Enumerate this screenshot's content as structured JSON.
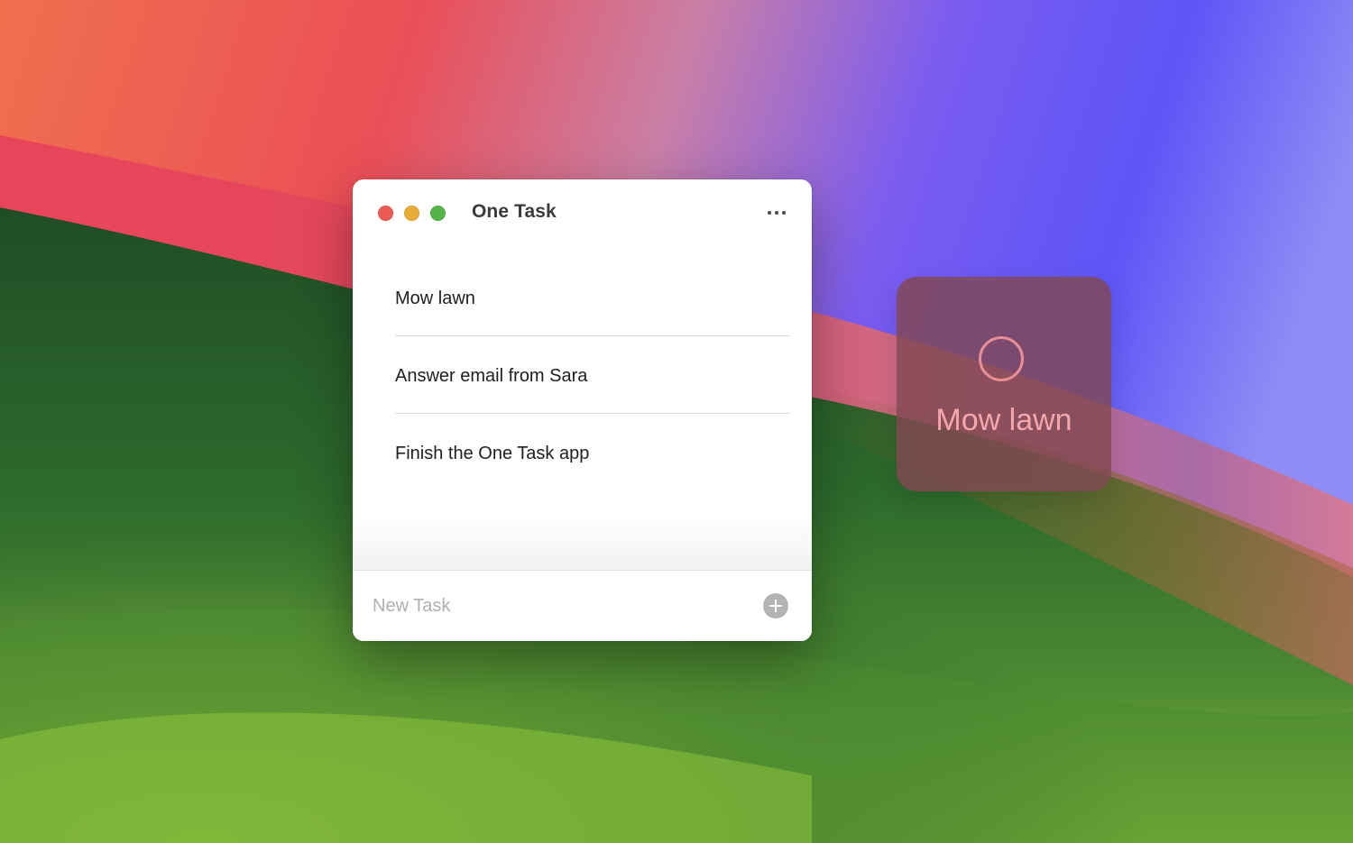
{
  "window": {
    "title": "One Task",
    "controls": {
      "close_color": "#ec5a51",
      "minimize_color": "#e8ac36",
      "maximize_color": "#55b447"
    },
    "more_icon": "ellipsis-icon"
  },
  "tasks": [
    {
      "label": "Mow lawn"
    },
    {
      "label": "Answer email from Sara"
    },
    {
      "label": "Finish the One Task app"
    }
  ],
  "footer": {
    "placeholder": "New Task",
    "value": "",
    "add_icon": "plus-circle-icon"
  },
  "widget": {
    "label": "Mow lawn",
    "icon": "empty-circle-icon"
  }
}
